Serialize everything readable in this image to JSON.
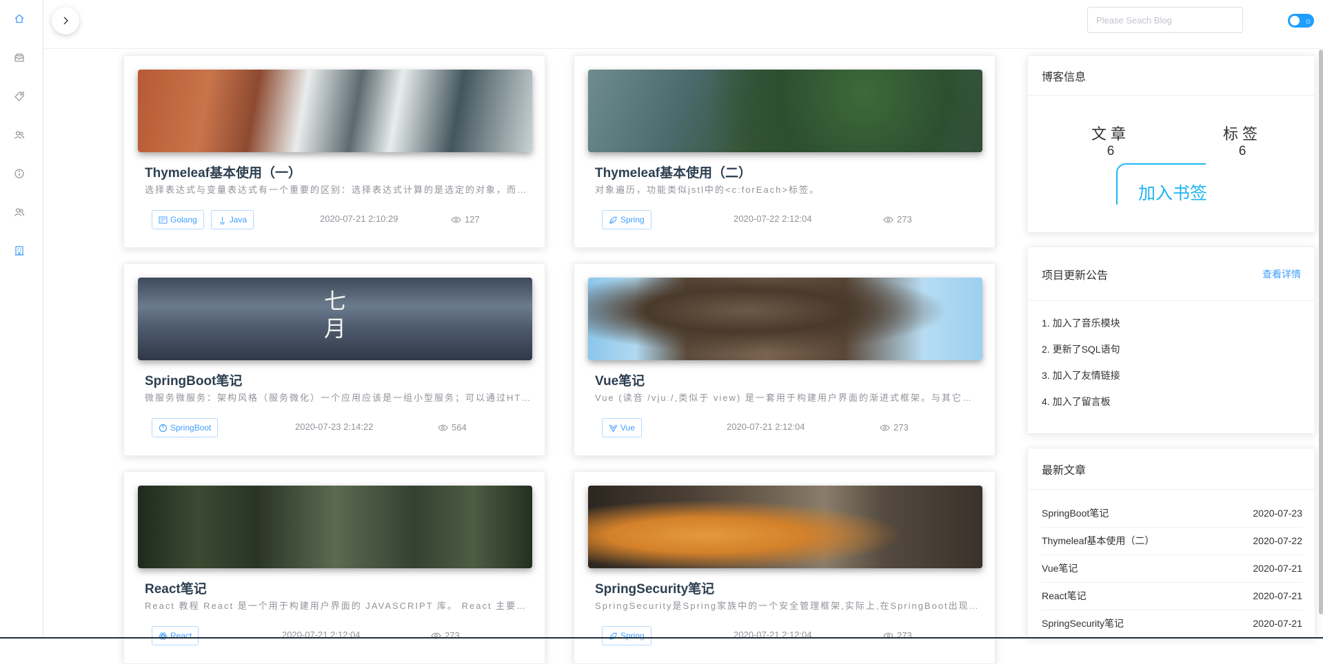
{
  "header": {
    "search_placeholder": "Please Seach Blog"
  },
  "sidebar": {
    "items": [
      {
        "icon": "home-icon"
      },
      {
        "icon": "archive-icon"
      },
      {
        "icon": "tag-icon"
      },
      {
        "icon": "users-icon"
      },
      {
        "icon": "info-icon"
      },
      {
        "icon": "friends-icon"
      },
      {
        "icon": "building-icon"
      }
    ]
  },
  "cards": [
    {
      "title": "Thymeleaf基本使用（一）",
      "desc": "选择表达式与变量表达式有一个重要的区别：选择表达式计算的是选定的对象，而不是整个环境变量映射",
      "tags": [
        {
          "label": "Golang",
          "icon": "golang-icon"
        },
        {
          "label": "Java",
          "icon": "java-icon"
        }
      ],
      "date": "2020-07-21 2:10:29",
      "views": "127"
    },
    {
      "title": "Thymeleaf基本使用（二）",
      "desc": "对象遍历，功能类似jstl中的<c:forEach>标签。",
      "tags": [
        {
          "label": "Spring",
          "icon": "spring-icon"
        }
      ],
      "date": "2020-07-22 2:12:04",
      "views": "273"
    },
    {
      "title": "SpringBoot笔记",
      "desc": "微服务微服务：架构风格（服务微化）一个应用应该是一组小型服务；可以通过HTTP的方式进行互通",
      "tags": [
        {
          "label": "SpringBoot",
          "icon": "springboot-icon"
        }
      ],
      "date": "2020-07-23 2:14:22",
      "views": "564",
      "image_text": "七\n月"
    },
    {
      "title": "Vue笔记",
      "desc": "Vue (读音 /vjuː/,类似于 view) 是一套用于构建用户界面的渐进式框架。与其它大型框架不同的是",
      "tags": [
        {
          "label": "Vue",
          "icon": "vue-icon"
        }
      ],
      "date": "2020-07-21 2:12:04",
      "views": "273"
    },
    {
      "title": "React笔记",
      "desc": "React 教程 React 是一个用于构建用户界面的 JAVASCRIPT 库。 React 主要用于构建UI",
      "tags": [
        {
          "label": "React",
          "icon": "react-icon"
        }
      ],
      "date": "2020-07-21 2:12:04",
      "views": "273"
    },
    {
      "title": "SpringSecurity笔记",
      "desc": "SpringSecurity是Spring家族中的一个安全管理框架,实际上,在SpringBoot出现之前",
      "tags": [
        {
          "label": "Spring",
          "icon": "spring-icon"
        }
      ],
      "date": "2020-07-21 2:12:04",
      "views": "273"
    }
  ],
  "blog_info": {
    "title": "博客信息",
    "articles_label": "文章",
    "articles_count": "6",
    "tags_label": "标签",
    "tags_count": "6",
    "bookmark_label": "加入书签"
  },
  "notice": {
    "title": "项目更新公告",
    "link": "查看详情",
    "items": [
      "1. 加入了音乐模块",
      "2. 更新了SQL语句",
      "3. 加入了友情链接",
      "4. 加入了留言板"
    ]
  },
  "latest": {
    "title": "最新文章",
    "items": [
      {
        "title": "SpringBoot笔记",
        "date": "2020-07-23"
      },
      {
        "title": "Thymeleaf基本使用（二）",
        "date": "2020-07-22"
      },
      {
        "title": "Vue笔记",
        "date": "2020-07-21"
      },
      {
        "title": "React笔记",
        "date": "2020-07-21"
      },
      {
        "title": "SpringSecurity笔记",
        "date": "2020-07-21"
      }
    ]
  },
  "colors": {
    "accent": "#409eff",
    "bookmark": "#1eb4f5",
    "switch": "#1e9fff"
  }
}
